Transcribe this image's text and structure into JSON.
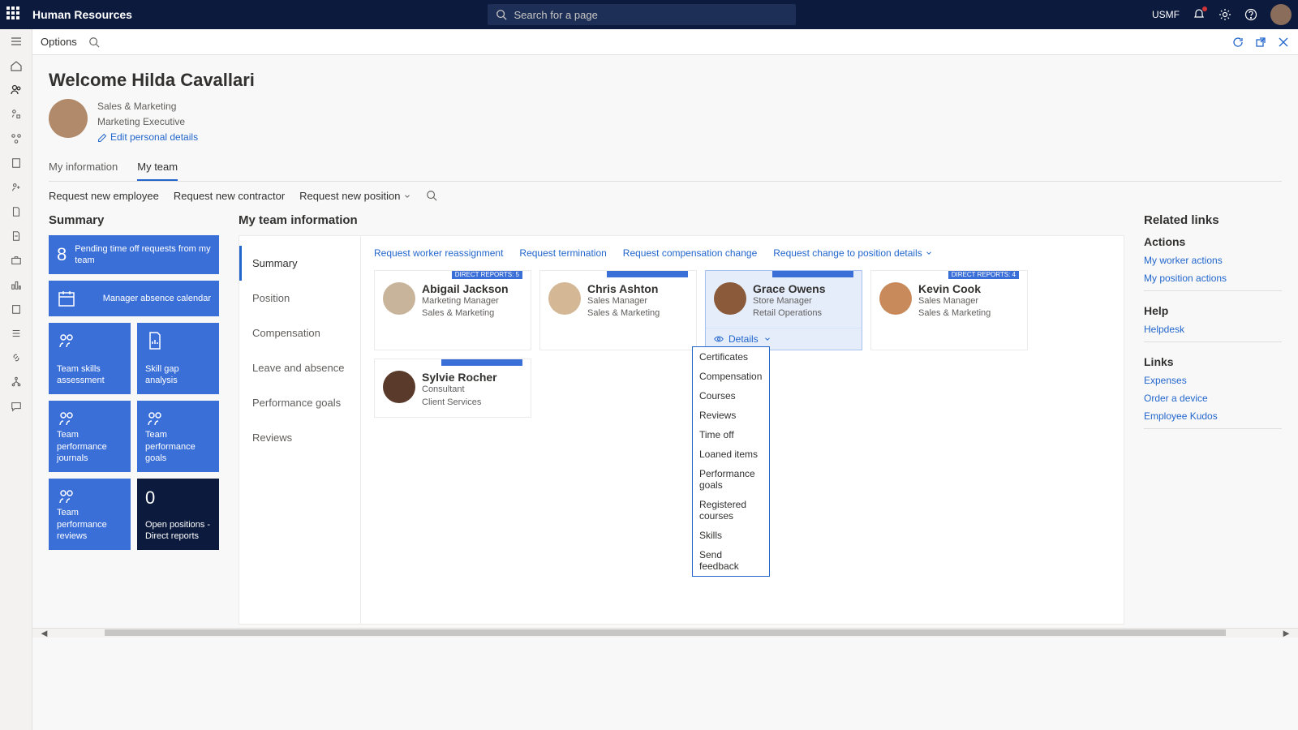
{
  "topbar": {
    "title": "Human Resources",
    "search_placeholder": "Search for a page",
    "company": "USMF"
  },
  "actionbar": {
    "options": "Options"
  },
  "welcome": "Welcome Hilda Cavallari",
  "profile": {
    "dept": "Sales & Marketing",
    "title": "Marketing Executive",
    "edit": "Edit personal details"
  },
  "tabs": {
    "my_info": "My information",
    "my_team": "My team"
  },
  "requests": {
    "new_employee": "Request new employee",
    "new_contractor": "Request new contractor",
    "new_position": "Request new position"
  },
  "summary": {
    "title": "Summary",
    "pending_count": "8",
    "pending_label": "Pending time off requests from my team",
    "absence_cal": "Manager absence calendar",
    "skills_assess": "Team skills assessment",
    "skill_gap": "Skill gap analysis",
    "perf_journals": "Team performance journals",
    "perf_goals": "Team performance goals",
    "perf_reviews": "Team performance reviews",
    "open_count": "0",
    "open_label": "Open positions - Direct reports"
  },
  "team": {
    "title": "My team information",
    "nav": {
      "summary": "Summary",
      "position": "Position",
      "compensation": "Compensation",
      "leave": "Leave and absence",
      "goals": "Performance goals",
      "reviews": "Reviews"
    },
    "links": {
      "reassign": "Request worker reassignment",
      "terminate": "Request termination",
      "comp_change": "Request compensation change",
      "pos_change": "Request change to position details"
    },
    "details_label": "Details",
    "cards": [
      {
        "name": "Abigail Jackson",
        "role": "Marketing Manager",
        "dept": "Sales & Marketing",
        "badge": "DIRECT REPORTS: 5"
      },
      {
        "name": "Chris Ashton",
        "role": "Sales Manager",
        "dept": "Sales & Marketing",
        "badge": ""
      },
      {
        "name": "Grace Owens",
        "role": "Store Manager",
        "dept": "Retail Operations",
        "badge": ""
      },
      {
        "name": "Kevin Cook",
        "role": "Sales Manager",
        "dept": "Sales & Marketing",
        "badge": "DIRECT REPORTS: 4"
      },
      {
        "name": "Sylvie Rocher",
        "role": "Consultant",
        "dept": "Client Services",
        "badge": ""
      }
    ],
    "dropdown": [
      "Certificates",
      "Compensation",
      "Courses",
      "Reviews",
      "Time off",
      "Loaned items",
      "Performance goals",
      "Registered courses",
      "Skills",
      "Send feedback"
    ]
  },
  "related": {
    "title": "Related links",
    "actions_title": "Actions",
    "actions": [
      "My worker actions",
      "My position actions"
    ],
    "help_title": "Help",
    "help": [
      "Helpdesk"
    ],
    "links_title": "Links",
    "links": [
      "Expenses",
      "Order a device",
      "Employee Kudos"
    ]
  }
}
